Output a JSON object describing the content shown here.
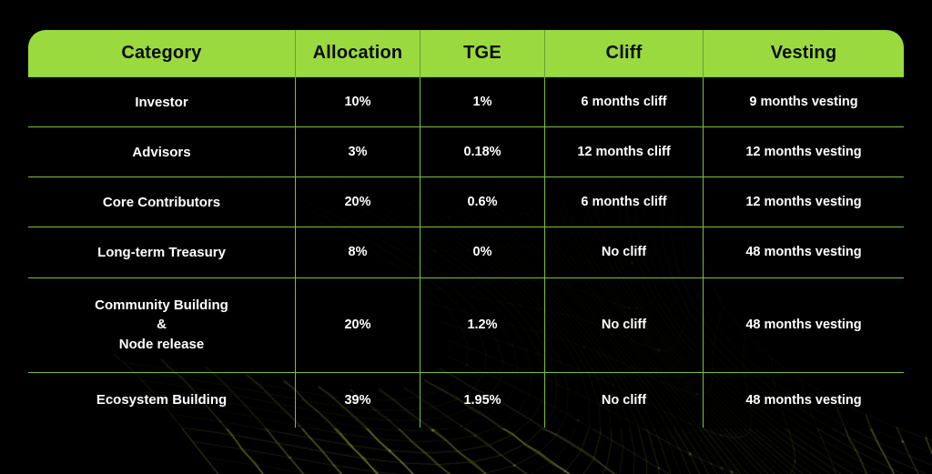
{
  "theme": {
    "header_bg": "#9ada3f",
    "header_text": "#0a0a0a",
    "grid_line": "#7cc03c",
    "body_text": "#ffffff",
    "page_bg": "#000000",
    "mesh_color": "#9aa832"
  },
  "table": {
    "columns": [
      {
        "key": "category",
        "label": "Category"
      },
      {
        "key": "allocation",
        "label": "Allocation"
      },
      {
        "key": "tge",
        "label": "TGE"
      },
      {
        "key": "cliff",
        "label": "Cliff"
      },
      {
        "key": "vesting",
        "label": "Vesting"
      }
    ],
    "rows": [
      {
        "category": "Investor",
        "allocation": "10%",
        "tge": "1%",
        "cliff": "6 months cliff",
        "vesting": "9 months vesting"
      },
      {
        "category": "Advisors",
        "allocation": "3%",
        "tge": "0.18%",
        "cliff": "12 months cliff",
        "vesting": "12 months vesting"
      },
      {
        "category": "Core Contributors",
        "allocation": "20%",
        "tge": "0.6%",
        "cliff": "6 months cliff",
        "vesting": "12 months vesting"
      },
      {
        "category": "Long-term Treasury",
        "allocation": "8%",
        "tge": "0%",
        "cliff": "No cliff",
        "vesting": "48 months vesting"
      },
      {
        "category_line1": "Community Building",
        "category_line2": "&",
        "category_line3": "Node release",
        "allocation": "20%",
        "tge": "1.2%",
        "cliff": "No cliff",
        "vesting": "48 months vesting"
      },
      {
        "category": "Ecosystem Building",
        "allocation": "39%",
        "tge": "1.95%",
        "cliff": "No cliff",
        "vesting": "48 months vesting"
      }
    ]
  }
}
